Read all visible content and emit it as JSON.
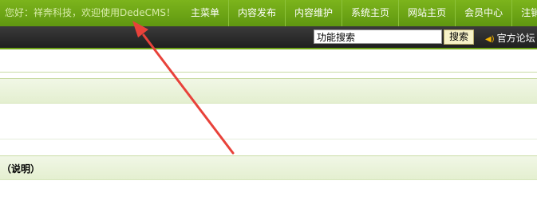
{
  "header": {
    "welcome": "您好：祥奔科技，欢迎使用DedeCMS！",
    "nav": [
      "主菜单",
      "内容发布",
      "内容维护",
      "系统主页",
      "网站主页",
      "会员中心",
      "注销"
    ]
  },
  "toolbar": {
    "search_value": "功能搜索",
    "search_button": "搜索",
    "forum_link": "官方论坛"
  },
  "content": {
    "section_title": "（说明）"
  },
  "colors": {
    "header_green": "#6fa416",
    "annotation_arrow": "#e8423a"
  }
}
